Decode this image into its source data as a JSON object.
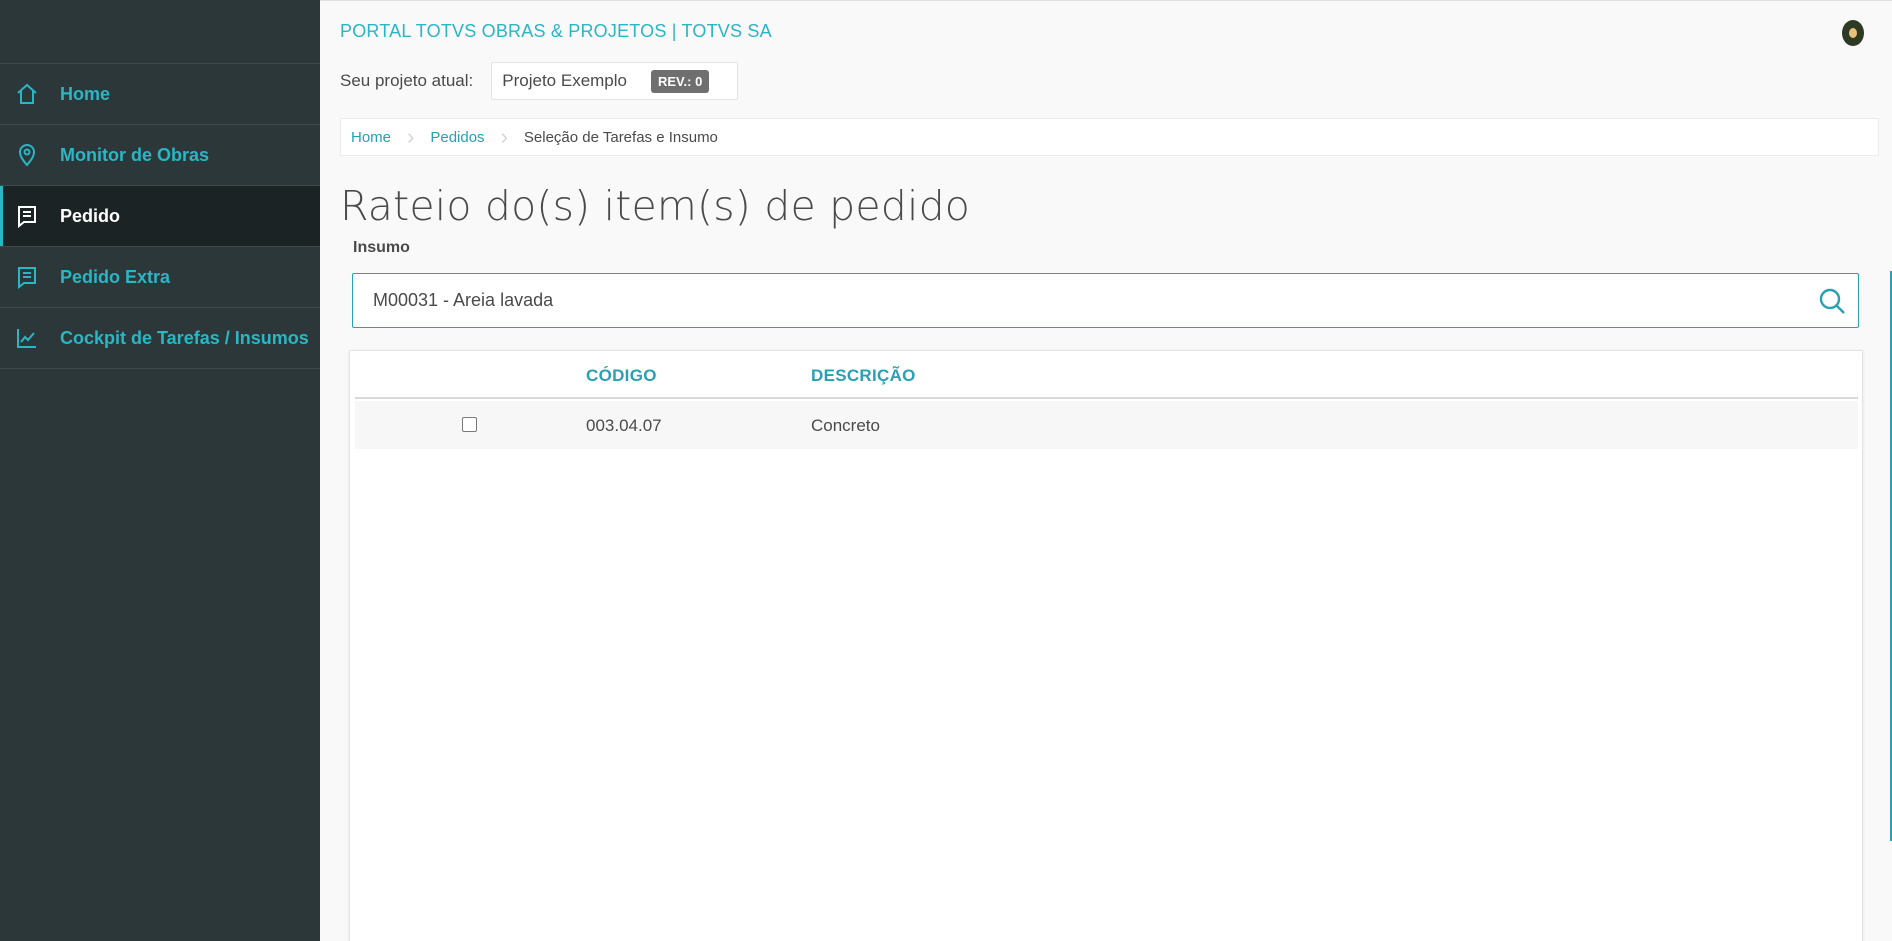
{
  "sidebar": {
    "items": [
      {
        "label": "Home",
        "icon": "home-icon"
      },
      {
        "label": "Monitor de Obras",
        "icon": "map-pin-icon"
      },
      {
        "label": "Pedido",
        "icon": "receipt-icon",
        "active": true
      },
      {
        "label": "Pedido Extra",
        "icon": "receipt-icon"
      },
      {
        "label": "Cockpit de Tarefas / Insumos",
        "icon": "chart-line-icon"
      }
    ]
  },
  "header": {
    "app_title": "PORTAL TOTVS OBRAS & PROJETOS | TOTVS SA",
    "project_label": "Seu projeto atual:",
    "project_name": "Projeto Exemplo",
    "revision_badge": "REV.: 0"
  },
  "breadcrumb": [
    "Home",
    "Pedidos",
    "Seleção de Tarefas e Insumo"
  ],
  "page": {
    "title": "Rateio do(s) item(s) de pedido",
    "insumo_label": "Insumo",
    "insumo_value": "M00031 - Areia lavada"
  },
  "table": {
    "columns": [
      "",
      "CÓDIGO",
      "DESCRIÇÃO"
    ],
    "rows": [
      {
        "checked": false,
        "codigo": "003.04.07",
        "descricao": "Concreto"
      }
    ]
  },
  "colors": {
    "accent": "#29b6c5",
    "link": "#29a0b4",
    "sidebar_bg": "#2c3739",
    "sidebar_active_bg": "#1c2325"
  }
}
